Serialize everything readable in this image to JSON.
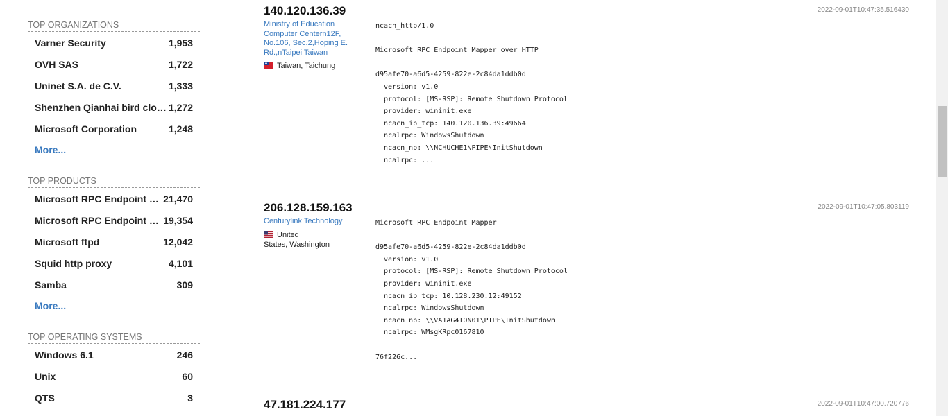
{
  "sidebar": {
    "organizations": {
      "title": "TOP ORGANIZATIONS",
      "items": [
        {
          "name": "Varner Security",
          "count": "1,953"
        },
        {
          "name": "OVH SAS",
          "count": "1,722"
        },
        {
          "name": "Uninet S.A. de C.V.",
          "count": "1,333"
        },
        {
          "name": "Shenzhen Qianhai bird cloud...",
          "count": "1,272"
        },
        {
          "name": "Microsoft Corporation",
          "count": "1,248"
        }
      ],
      "more": "More..."
    },
    "products": {
      "title": "TOP PRODUCTS",
      "items": [
        {
          "name": "Microsoft RPC Endpoint Ma...",
          "count": "21,470"
        },
        {
          "name": "Microsoft RPC Endpoint Ma...",
          "count": "19,354"
        },
        {
          "name": "Microsoft ftpd",
          "count": "12,042"
        },
        {
          "name": "Squid http proxy",
          "count": "4,101"
        },
        {
          "name": "Samba",
          "count": "309"
        }
      ],
      "more": "More..."
    },
    "os": {
      "title": "TOP OPERATING SYSTEMS",
      "items": [
        {
          "name": "Windows 6.1",
          "count": "246"
        },
        {
          "name": "Unix",
          "count": "60"
        },
        {
          "name": "QTS",
          "count": "3"
        }
      ]
    }
  },
  "results": [
    {
      "ip": "140.120.136.39",
      "timestamp": "2022-09-01T10:47:35.516430",
      "org": "Ministry of Education Computer Centern12F, No.106, Sec.2,Hoping E. Rd.,nTaipei Taiwan",
      "flag": "tw-flag-icon",
      "location": "Taiwan, Taichung",
      "banner": "ncacn_http/1.0\n\nMicrosoft RPC Endpoint Mapper over HTTP\n\nd95afe70-a6d5-4259-822e-2c84da1ddb0d\n  version: v1.0\n  protocol: [MS-RSP]: Remote Shutdown Protocol\n  provider: wininit.exe\n  ncacn_ip_tcp: 140.120.136.39:49664\n  ncalrpc: WindowsShutdown\n  ncacn_np: \\\\NCHUCHE1\\PIPE\\InitShutdown\n  ncalrpc: ..."
    },
    {
      "ip": "206.128.159.163",
      "timestamp": "2022-09-01T10:47:05.803119",
      "org": "Centurylink Technology",
      "flag": "us-flag-icon",
      "location_line1": "United",
      "location_line2": "States, Washington",
      "banner": "Microsoft RPC Endpoint Mapper\n\nd95afe70-a6d5-4259-822e-2c84da1ddb0d\n  version: v1.0\n  protocol: [MS-RSP]: Remote Shutdown Protocol\n  provider: wininit.exe\n  ncacn_ip_tcp: 10.128.230.12:49152\n  ncalrpc: WindowsShutdown\n  ncacn_np: \\\\VA1AG4ION01\\PIPE\\InitShutdown\n  ncalrpc: WMsgKRpc0167810\n\n76f226c..."
    },
    {
      "ip": "47.181.224.177",
      "timestamp": "2022-09-01T10:47:00.720776"
    }
  ],
  "colors": {
    "link": "#3a7abf",
    "heading": "#777777",
    "text": "#222222"
  }
}
